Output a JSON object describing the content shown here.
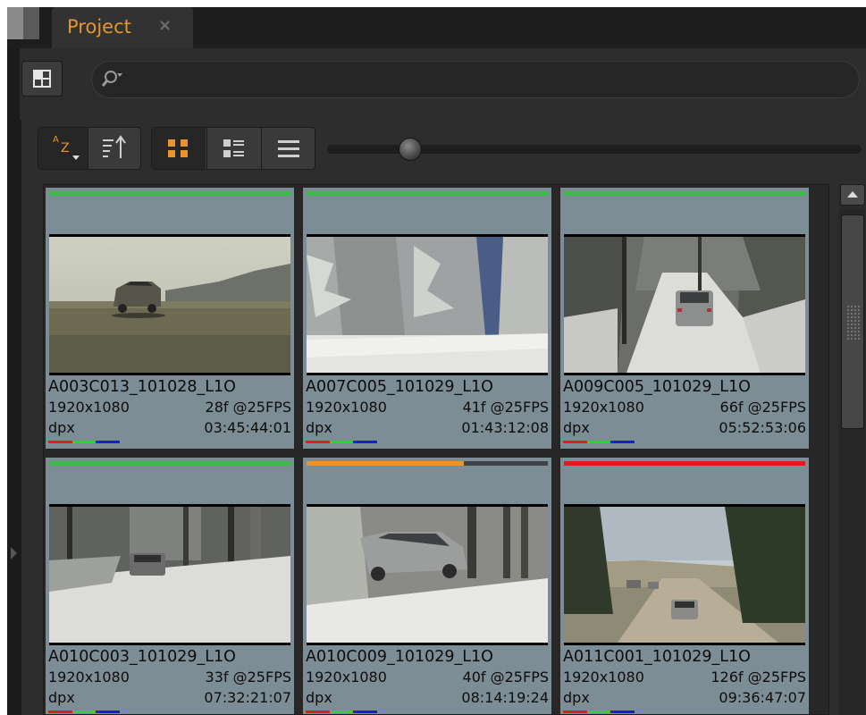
{
  "tab": {
    "title": "Project",
    "close": "×"
  },
  "search": {
    "placeholder": "",
    "value": ""
  },
  "toolbar": {
    "sort_a": "A",
    "sort_z": "Z",
    "view_mode": "thumbnail",
    "slider_value": 0.14
  },
  "colors": {
    "accent": "#e8952c",
    "card_bg": "#7c8d95",
    "status_green": "#3dbb48",
    "status_orange": "#e8952c",
    "status_red": "#e3191c"
  },
  "clips": [
    {
      "name": "A003C013_101028_L1O",
      "resolution": "1920x1080",
      "frames": "28f @25FPS",
      "format": "dpx",
      "timecode": "03:45:44:01",
      "status_color": "#3dbb48",
      "status_progress": 1.0,
      "thumbnail": "car-on-road-landscape"
    },
    {
      "name": "A007C005_101029_L1O",
      "resolution": "1920x1080",
      "frames": "41f @25FPS",
      "format": "dpx",
      "timecode": "01:43:12:08",
      "status_color": "#3dbb48",
      "status_progress": 1.0,
      "thumbnail": "snowy-forest"
    },
    {
      "name": "A009C005_101029_L1O",
      "resolution": "1920x1080",
      "frames": "66f @25FPS",
      "format": "dpx",
      "timecode": "05:52:53:06",
      "status_color": "#3dbb48",
      "status_progress": 1.0,
      "thumbnail": "car-snowy-road"
    },
    {
      "name": "A010C003_101029_L1O",
      "resolution": "1920x1080",
      "frames": "33f @25FPS",
      "format": "dpx",
      "timecode": "07:32:21:07",
      "status_color": "#3dbb48",
      "status_progress": 1.0,
      "thumbnail": "car-snowy-forest"
    },
    {
      "name": "A010C009_101029_L1O",
      "resolution": "1920x1080",
      "frames": "40f @25FPS",
      "format": "dpx",
      "timecode": "08:14:19:24",
      "status_color": "#e8952c",
      "status_progress": 0.65,
      "thumbnail": "car-in-snow"
    },
    {
      "name": "A011C001_101029_L1O",
      "resolution": "1920x1080",
      "frames": "126f @25FPS",
      "format": "dpx",
      "timecode": "09:36:47:07",
      "status_color": "#e3191c",
      "status_progress": 1.0,
      "thumbnail": "cars-dirt-road"
    }
  ]
}
